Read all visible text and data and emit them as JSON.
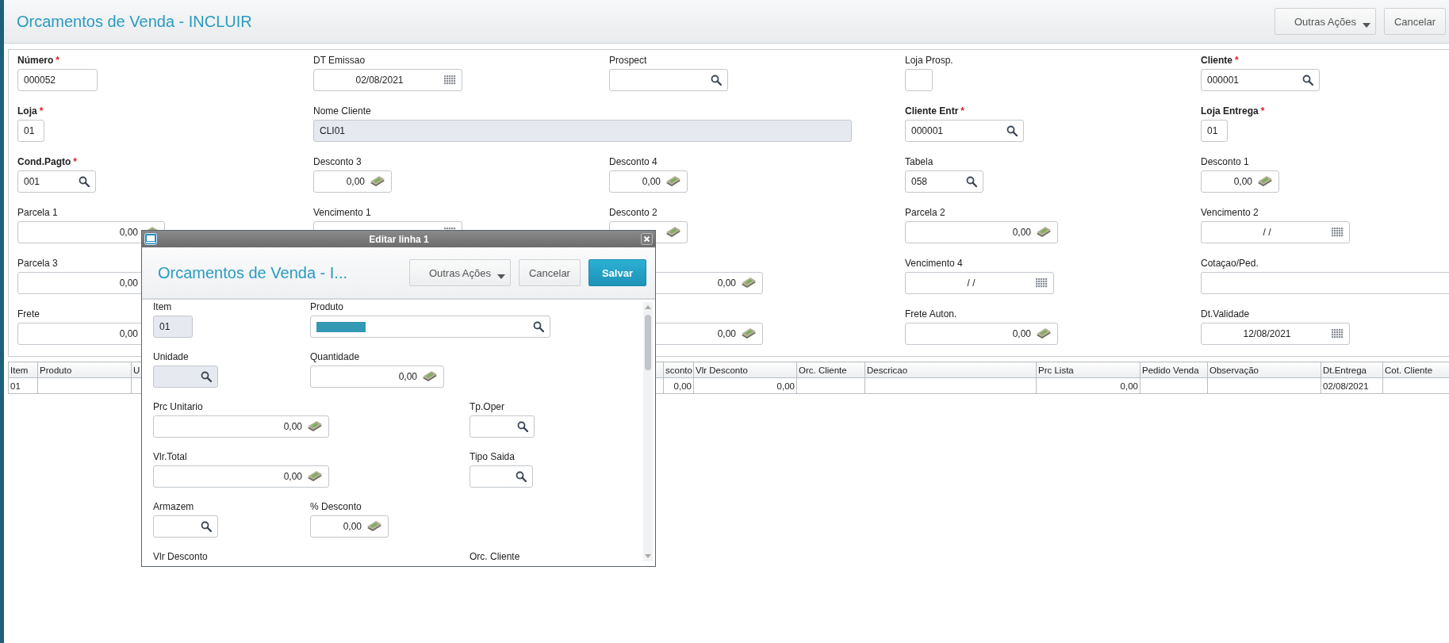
{
  "header": {
    "title": "Orcamentos de Venda - INCLUIR",
    "buttons": [
      {
        "label": "Outras Ações",
        "kind": "dropdown"
      },
      {
        "label": "Cancelar",
        "kind": "plain"
      }
    ]
  },
  "form": {
    "rows": [
      {
        "fields": [
          {
            "label": "Número",
            "asterisk": "*",
            "kind": "text",
            "value": "000052",
            "disabled": false
          },
          {
            "label": "DT Emissao",
            "kind": "date",
            "value": "02/08/2021",
            "disabled": false
          },
          {
            "label": "Prospect",
            "kind": "search",
            "disabled": false
          },
          {
            "label": "Loja Prosp.",
            "kind": "text",
            "disabled": false
          },
          {
            "label": "Cliente",
            "asterisk": "*",
            "kind": "search",
            "value": "000001",
            "disabled": false
          }
        ]
      },
      {
        "fields": [
          {
            "label": "Loja",
            "asterisk": "*",
            "kind": "text",
            "value": "01",
            "disabled": false
          },
          {
            "label": "Nome Cliente",
            "kind": "text",
            "value": "CLI01",
            "disabled": true
          },
          {
            "label": "Cliente Entr",
            "asterisk": "*",
            "kind": "search",
            "value": "000001",
            "disabled": false
          },
          {
            "label": "Loja Entrega",
            "asterisk": "*",
            "kind": "text",
            "value": "01",
            "disabled": false
          }
        ]
      },
      {
        "fields": [
          {
            "label": "Cond.Pagto",
            "asterisk": "*",
            "kind": "search",
            "value": "001",
            "disabled": false
          },
          {
            "label": "Desconto 3",
            "kind": "money",
            "value": "0,00",
            "disabled": false
          },
          {
            "label": "Desconto 4",
            "kind": "money",
            "value": "0,00",
            "disabled": false
          },
          {
            "label": "Tabela",
            "kind": "search",
            "value": "058",
            "disabled": false
          },
          {
            "label": "Desconto 1",
            "kind": "money",
            "value": "0,00",
            "disabled": false
          }
        ]
      },
      {
        "fields": [
          {
            "label": "Parcela 1",
            "kind": "money",
            "value": "0,00",
            "disabled": false
          },
          {
            "label": "Vencimento 1",
            "kind": "date",
            "disabled": false
          },
          {
            "label": "Desconto 2",
            "kind": "money",
            "disabled": false
          },
          {
            "label": "Parcela 2",
            "kind": "money",
            "value": "0,00",
            "disabled": false
          },
          {
            "label": "Vencimento 2",
            "kind": "date",
            "value": "/ /",
            "disabled": false
          }
        ]
      },
      {
        "fields": [
          {
            "label": "Parcela 3",
            "kind": "number",
            "value": "0,00",
            "disabled": false
          },
          {
            "kind": "money",
            "value": "0,00",
            "disabled": false
          },
          {
            "label": "Vencimento 4",
            "kind": "date",
            "value": "/ /",
            "disabled": false
          },
          {
            "label": "Cotaçao/Ped.",
            "kind": "text",
            "disabled": false
          }
        ]
      },
      {
        "fields": [
          {
            "label": "Frete",
            "kind": "number",
            "value": "0,00",
            "disabled": false
          },
          {
            "kind": "money",
            "value": "0,00",
            "disabled": false
          },
          {
            "label": "Frete Auton.",
            "kind": "money",
            "value": "0,00",
            "disabled": false
          },
          {
            "label": "Dt.Validade",
            "kind": "date",
            "value": "12/08/2021",
            "disabled": false
          }
        ]
      }
    ]
  },
  "table": {
    "columns": [
      "Item",
      "Produto",
      "U",
      "sconto",
      "Vlr Desconto",
      "Orc. Cliente",
      "Descricao",
      "Prc Lista",
      "Pedido Venda",
      "Observação",
      "Dt.Entrega",
      "Cot. Cliente"
    ],
    "rows": [
      {
        "cells": [
          "01",
          null,
          null,
          "0,00",
          "0,00",
          null,
          null,
          "0,00",
          null,
          null,
          "02/08/2021",
          null
        ]
      }
    ]
  },
  "dialog": {
    "title": "Editar linha 1",
    "heading": "Orcamentos de Venda - I...",
    "buttons": [
      {
        "label": "Outras Ações",
        "kind": "dropdown"
      },
      {
        "label": "Cancelar",
        "kind": "plain"
      },
      {
        "label": "Salvar",
        "kind": "primary"
      }
    ],
    "rows": [
      {
        "fields": [
          {
            "label": "Item",
            "kind": "text",
            "value": "01",
            "disabled": true
          },
          {
            "label": "Produto",
            "kind": "search",
            "disabled": false,
            "highlighted": true
          }
        ]
      },
      {
        "fields": [
          {
            "label": "Unidade",
            "kind": "search",
            "disabled": true
          },
          {
            "label": "Quantidade",
            "kind": "money",
            "value": "0,00",
            "disabled": false
          }
        ]
      },
      {
        "fields": [
          {
            "label": "Prc Unitario",
            "kind": "money",
            "value": "0,00",
            "disabled": false
          },
          {
            "label": "Tp.Oper",
            "kind": "search",
            "disabled": false
          }
        ]
      },
      {
        "fields": [
          {
            "label": "Vlr.Total",
            "kind": "money",
            "value": "0,00",
            "disabled": false
          },
          {
            "label": "Tipo Saida",
            "kind": "search",
            "disabled": false
          }
        ]
      },
      {
        "fields": [
          {
            "label": "Armazem",
            "kind": "search",
            "disabled": false
          },
          {
            "label": "% Desconto",
            "kind": "money",
            "value": "0,00",
            "disabled": false
          }
        ]
      },
      {
        "fields": [
          {
            "label": "Vlr Desconto"
          },
          {
            "label": "Orc. Cliente"
          }
        ]
      }
    ]
  }
}
